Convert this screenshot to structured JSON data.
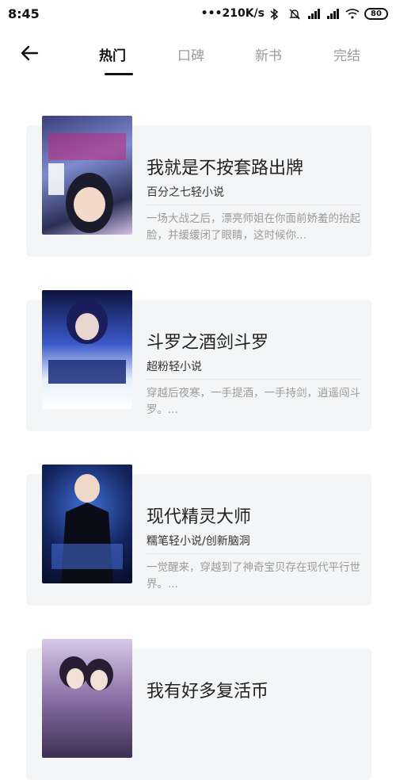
{
  "status_bar": {
    "time": "8:45",
    "network_speed": "•••210K/s",
    "battery": "80"
  },
  "nav": {
    "tabs": [
      "热门",
      "口碑",
      "新书",
      "完结"
    ],
    "active_index": 0
  },
  "books": [
    {
      "title": "我就是不按套路出牌",
      "meta": "百分之七轻小说",
      "description": "一场大战之后，漂亮师姐在你面前娇羞的抬起脸，并缓缓闭了眼睛，这时候你..."
    },
    {
      "title": "斗罗之酒剑斗罗",
      "meta": "超粉轻小说",
      "description": "穿越后夜寒，一手提酒，一手持剑，逍遥闯斗罗。..."
    },
    {
      "title": "现代精灵大师",
      "meta": "糯笔轻小说/创新脑洞",
      "description": "一觉醒来，穿越到了神奇宝贝存在现代平行世界。..."
    },
    {
      "title": "我有好多复活币",
      "meta": "",
      "description": ""
    }
  ],
  "colors": {
    "card_bg": "#f4f5f6",
    "active_tab": "#111111",
    "inactive_tab": "#9a9a9a"
  }
}
